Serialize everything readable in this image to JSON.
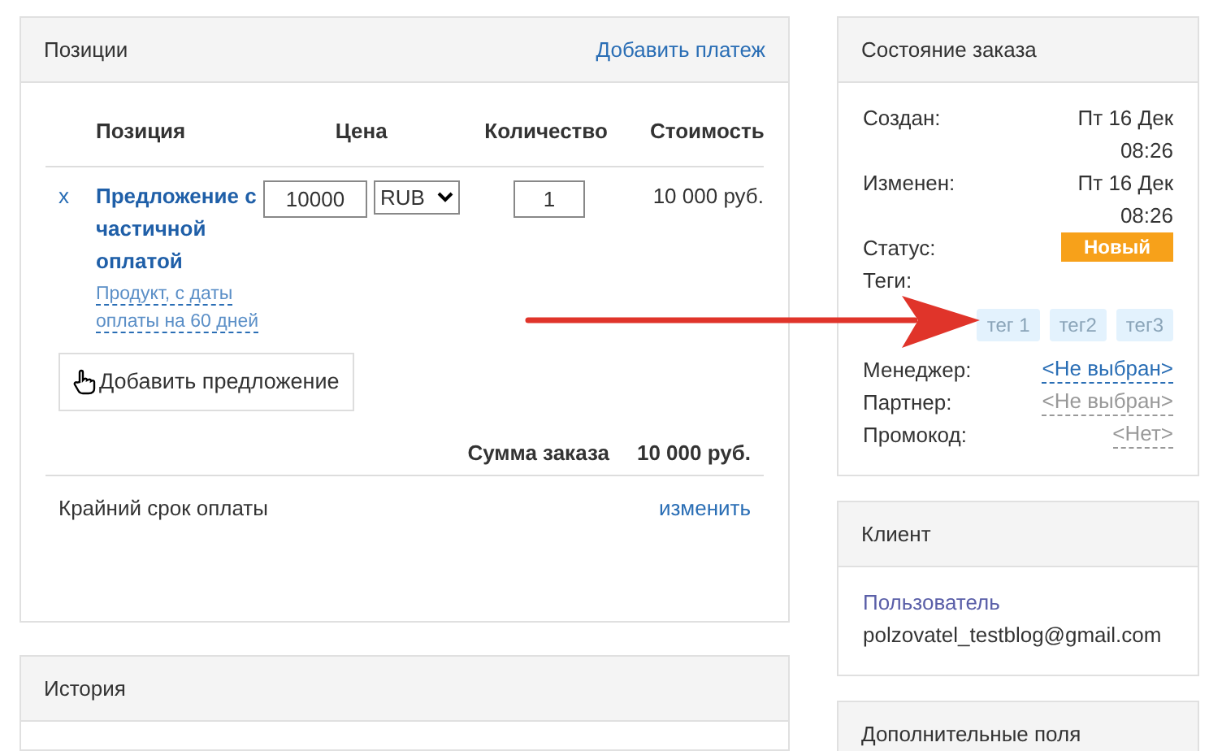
{
  "positions": {
    "title": "Позиции",
    "add_payment": "Добавить платеж",
    "columns": [
      "Позиция",
      "Цена",
      "Количество",
      "Стоимость"
    ],
    "rows": [
      {
        "remove": "x",
        "name": "Предложение с частичной оплатой",
        "description": "Продукт, с даты оплаты на 60 дней",
        "price": "10000",
        "currency": "RUB",
        "quantity": "1",
        "cost": "10 000 руб."
      }
    ],
    "add_offer": "Добавить предложение",
    "total_label": "Сумма заказа",
    "total_value": "10 000 руб.",
    "deadline_label": "Крайний срок оплаты",
    "deadline_action": "изменить"
  },
  "history": {
    "title": "История"
  },
  "order_state": {
    "title": "Состояние заказа",
    "fields": [
      {
        "label": "Создан:",
        "value": "Пт 16 Дек 08:26",
        "kind": "text"
      },
      {
        "label": "Изменен:",
        "value": "Пт 16 Дек 08:26",
        "kind": "text"
      },
      {
        "label": "Статус:",
        "value": "Новый",
        "kind": "badge",
        "color": "#f7a11a"
      },
      {
        "label": "Теги:",
        "kind": "tags",
        "tags": [
          "тег 1",
          "тег2",
          "тег3"
        ]
      },
      {
        "label": "Менеджер:",
        "value": "<Не выбран>",
        "kind": "link"
      },
      {
        "label": "Партнер:",
        "value": "<Не выбран>",
        "kind": "muted"
      },
      {
        "label": "Промокод:",
        "value": "<Нет>",
        "kind": "muted"
      }
    ]
  },
  "client": {
    "title": "Клиент",
    "name": "Пользователь",
    "email": "polzovatel_testblog@gmail.com"
  },
  "extra": {
    "title": "Дополнительные поля"
  }
}
